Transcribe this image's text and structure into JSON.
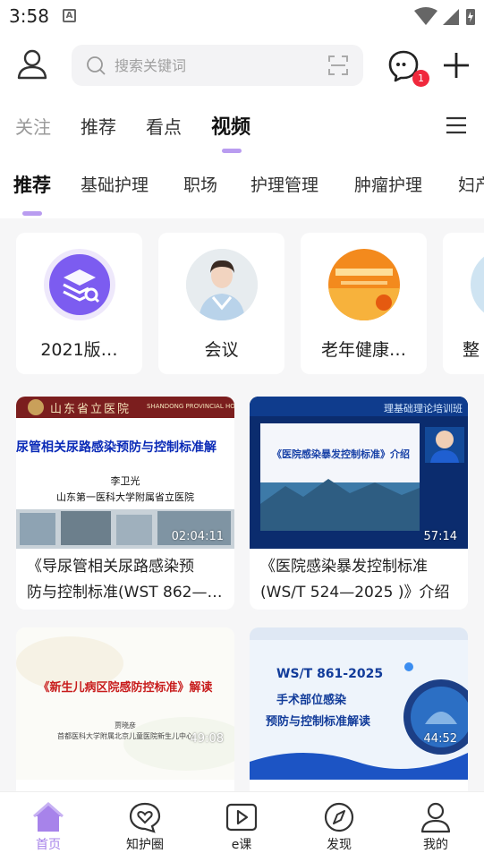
{
  "status": {
    "time": "3:58",
    "badge": "A"
  },
  "search": {
    "placeholder": "搜索关键词"
  },
  "messages": {
    "badge_count": "1"
  },
  "main_tabs": [
    {
      "label": "关注"
    },
    {
      "label": "推荐"
    },
    {
      "label": "看点"
    },
    {
      "label": "视频"
    }
  ],
  "sub_tabs": [
    {
      "label": "推荐"
    },
    {
      "label": "基础护理"
    },
    {
      "label": "职场"
    },
    {
      "label": "护理管理"
    },
    {
      "label": "肿瘤护理"
    },
    {
      "label": "妇产"
    }
  ],
  "categories": [
    {
      "label": "2021版…"
    },
    {
      "label": "会议"
    },
    {
      "label": "老年健康…"
    },
    {
      "label": "整"
    }
  ],
  "videos": [
    {
      "title_line1": "《导尿管相关尿路感染预",
      "title_line2": "防与控制标准(WST 862—2…",
      "duration": "02:04:11",
      "thumb": {
        "hospital": "山东省立医院",
        "hospital_en": "SHANDONG PROVINCIAL HO",
        "heading": "尿管相关尿路感染预防与控制标准解",
        "speaker": "李卫光",
        "org": "山东第一医科大学附属省立医院"
      }
    },
    {
      "title_line1": "《医院感染暴发控制标准",
      "title_line2": "(WS/T 524—2025 )》介绍",
      "duration": "57:14",
      "thumb": {
        "heading": "《医院感染暴发控制标准》介绍",
        "banner": "理基础理论培训班"
      }
    },
    {
      "title_line1": "",
      "title_line2": "",
      "duration": "49:08",
      "thumb": {
        "heading": "《新生儿病区院感防控标准》解读",
        "speaker": "贾晓彦",
        "org": "首都医科大学附属北京儿童医院新生儿中心"
      }
    },
    {
      "title_line1": "",
      "title_line2": "",
      "duration": "44:52",
      "thumb": {
        "line1": "WS/T 861-2025",
        "line2": "手术部位感染",
        "line3": "预防与控制标准解读"
      }
    }
  ],
  "bottom_nav": [
    {
      "label": "首页",
      "icon": "home-icon"
    },
    {
      "label": "知护圈",
      "icon": "heart-chat-icon"
    },
    {
      "label": "e课",
      "icon": "play-icon"
    },
    {
      "label": "发现",
      "icon": "compass-icon"
    },
    {
      "label": "我的",
      "icon": "person-icon"
    }
  ],
  "colors": {
    "accent": "#a783ea",
    "badge": "#f0283c"
  }
}
